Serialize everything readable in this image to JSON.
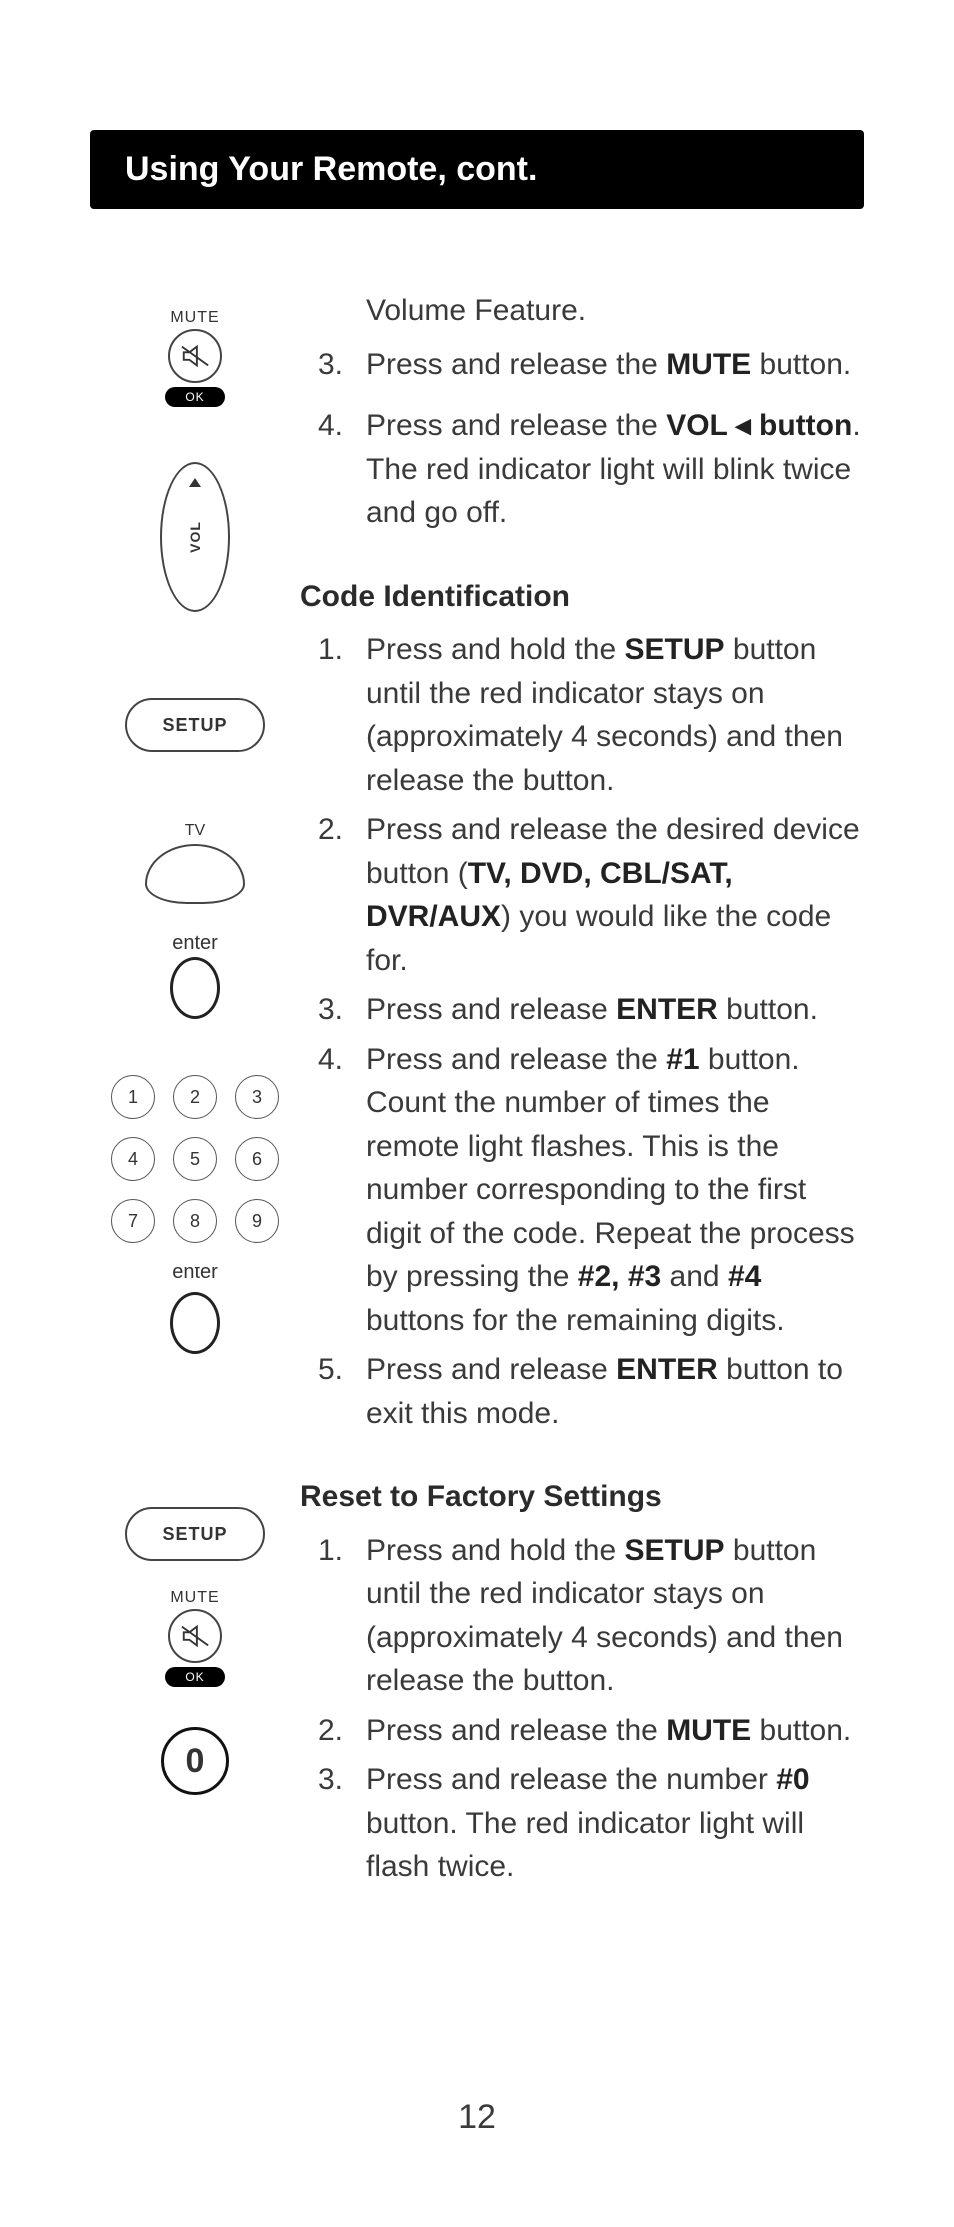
{
  "title": "Using Your Remote, cont.",
  "page_number": "12",
  "vol_feature_lead": "Volume Feature.",
  "vol_steps": {
    "s3": {
      "num": "3.",
      "pre": "Press and release the ",
      "bold": "MUTE",
      "post": " button."
    },
    "s4": {
      "num": "4.",
      "pre": "Press and release the ",
      "bold": "VOL ◂ button",
      "post": ". The red indicator light will blink twice and go off."
    }
  },
  "code_id_heading": "Code Identification",
  "code_steps": {
    "s1": {
      "num": "1.",
      "pre": "Press and hold the ",
      "bold": "SETUP",
      "post": " button until the red indicator stays on (approximately 4 seconds) and then release the button."
    },
    "s2": {
      "num": "2.",
      "pre": "Press and release the desired device button (",
      "bold": "TV, DVD, CBL/SAT, DVR/AUX",
      "post": ") you would like the code for."
    },
    "s3": {
      "num": "3.",
      "pre": "Press and release ",
      "bold": "ENTER",
      "post": " button."
    },
    "s4": {
      "num": "4.",
      "t1": "Press and release the ",
      "b1": "#1",
      "t2": " button. Count the number of times the remote light flashes. This is the number corresponding to the first digit of the code. Repeat the process by pressing the ",
      "b2": "#2, #3",
      "t3": " and ",
      "b3": "#4",
      "t4": " buttons for the remaining digits."
    },
    "s5": {
      "num": "5.",
      "pre": "Press and release ",
      "bold": "ENTER",
      "post": " button to exit this mode."
    }
  },
  "reset_heading": "Reset to Factory Settings",
  "reset_steps": {
    "s1": {
      "num": "1.",
      "pre": "Press and hold the ",
      "bold": "SETUP",
      "post": " button until the red indicator stays on (approximately 4 seconds) and then release the button."
    },
    "s2": {
      "num": "2.",
      "pre": "Press and release the ",
      "bold": "MUTE",
      "post": " button."
    },
    "s3": {
      "num": "3.",
      "pre": "Press and release the number ",
      "bold": "#0",
      "post": " button. The red indicator light will flash twice."
    }
  },
  "labels": {
    "mute": "MUTE",
    "ok": "OK",
    "vol": "VOL",
    "setup": "SETUP",
    "tv": "TV",
    "enter": "enter",
    "zero": "0"
  },
  "keypad": [
    "1",
    "2",
    "3",
    "4",
    "5",
    "6",
    "7",
    "8",
    "9"
  ]
}
